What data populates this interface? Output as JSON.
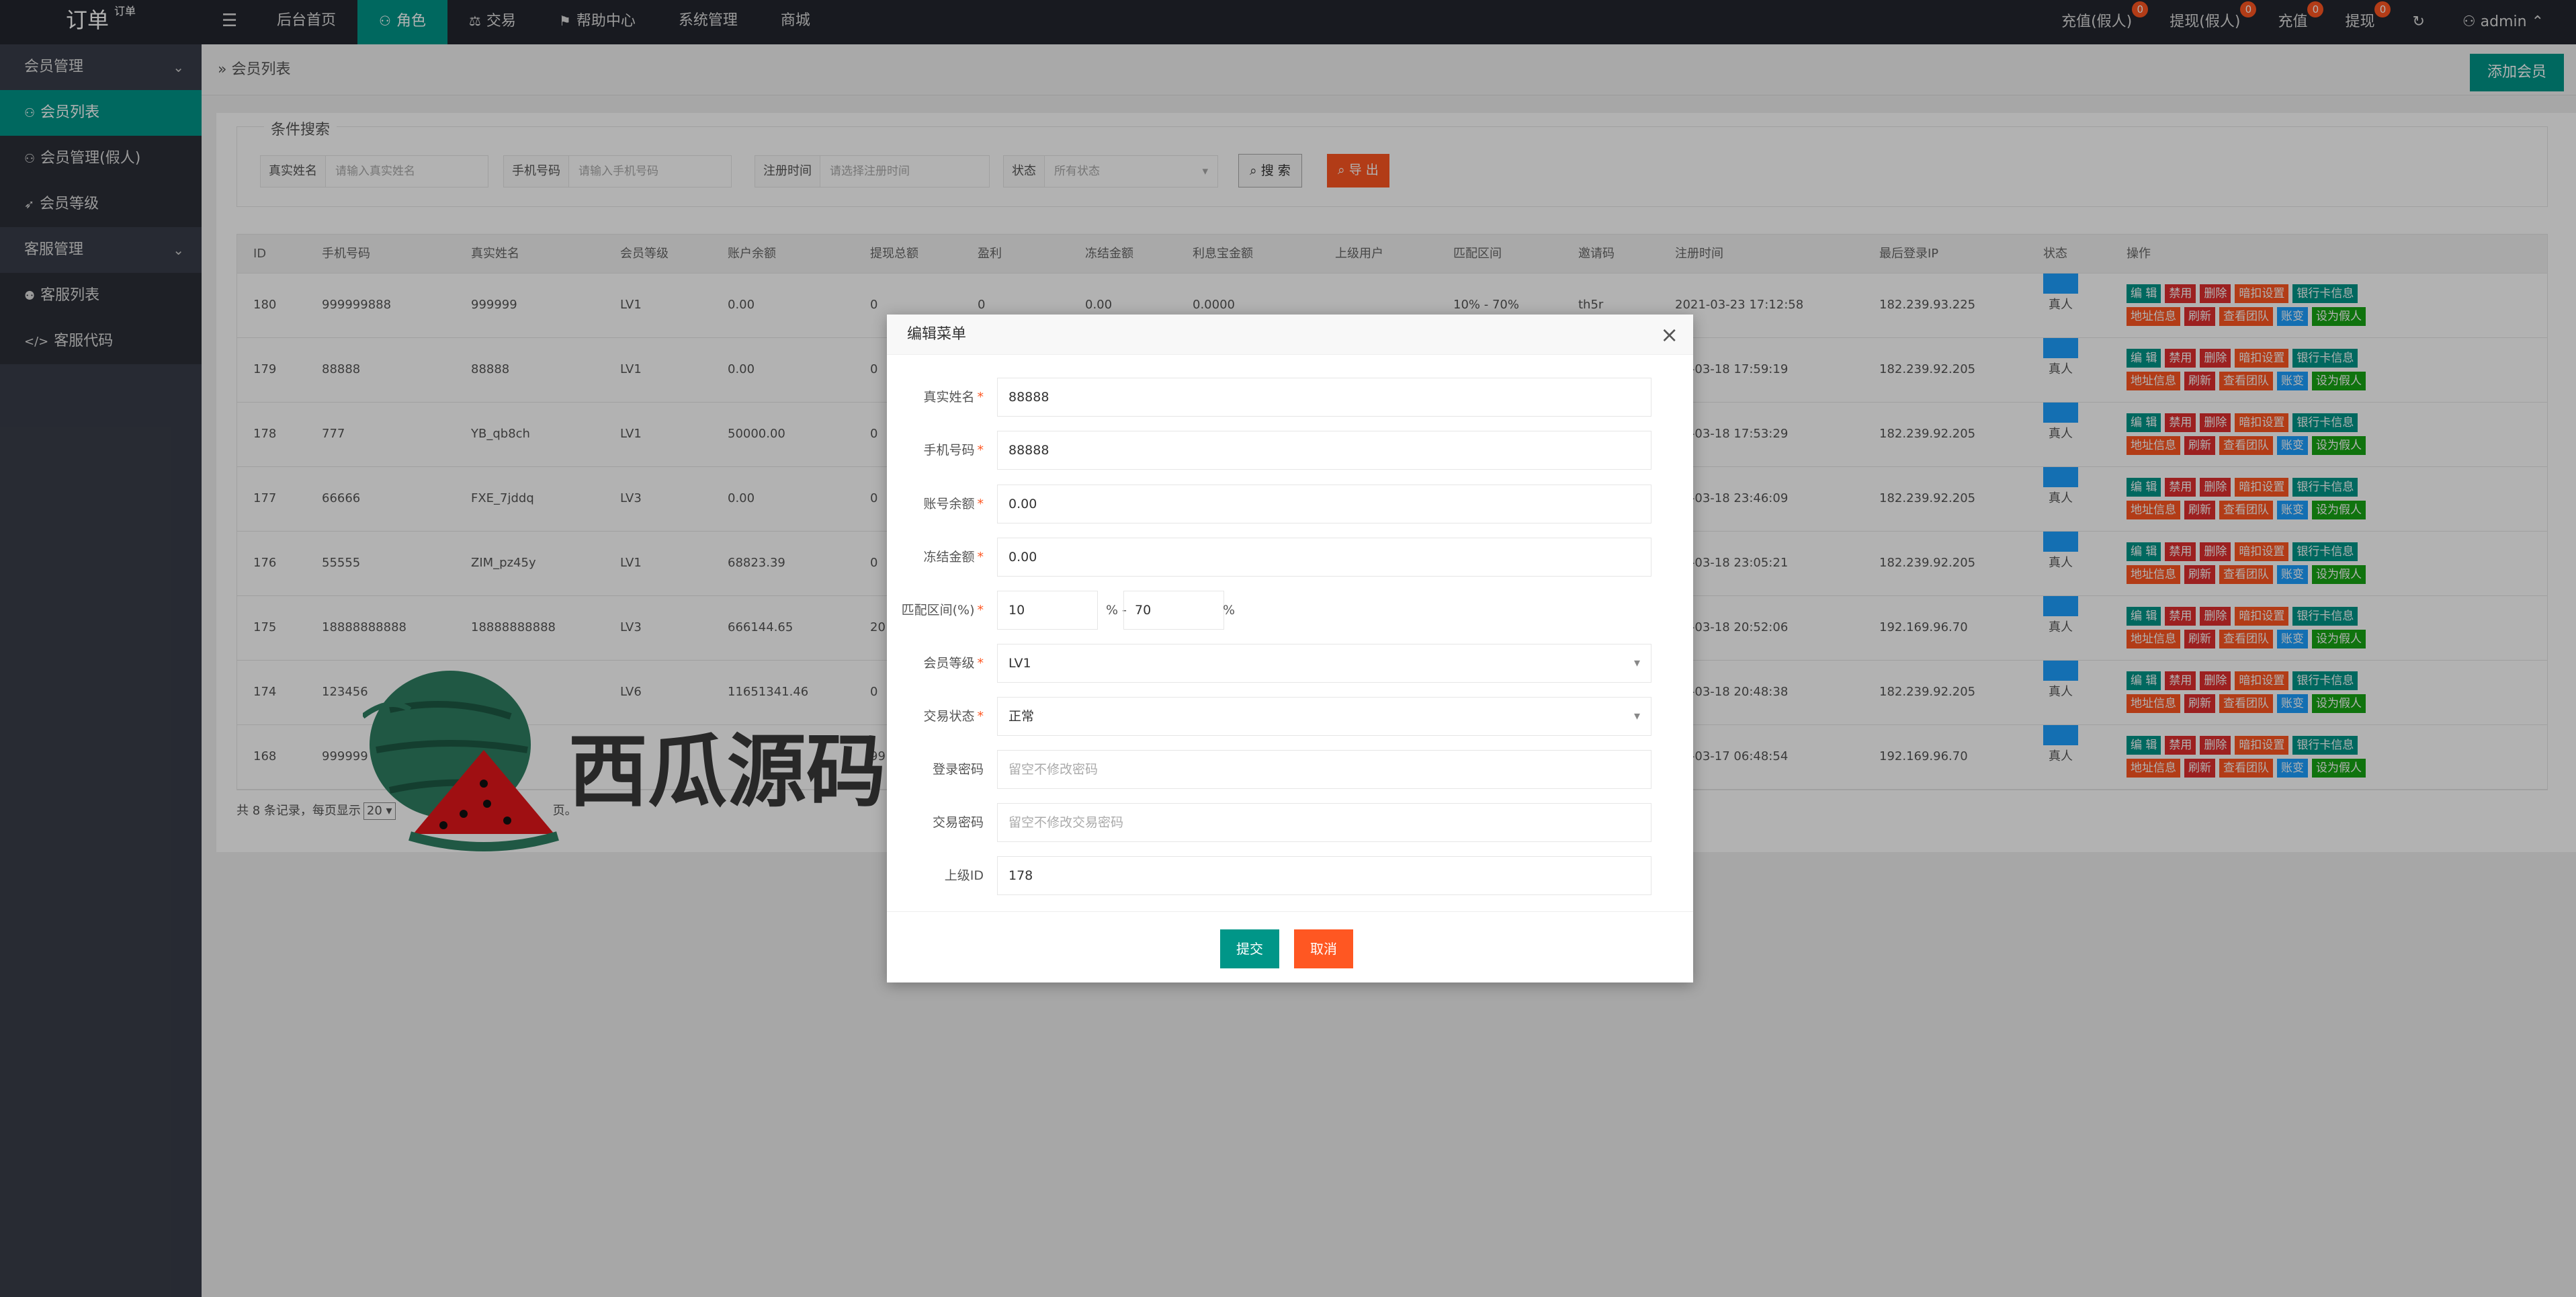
{
  "header": {
    "logo": "订单",
    "logo_sub": "订单",
    "menu_icon": "hamburger-icon",
    "nav": [
      {
        "label": "后台首页",
        "icon": ""
      },
      {
        "label": "角色",
        "icon": "user-icon"
      },
      {
        "label": "交易",
        "icon": "exchange-icon"
      },
      {
        "label": "帮助中心",
        "icon": "flag-icon"
      },
      {
        "label": "系统管理",
        "icon": ""
      },
      {
        "label": "商城",
        "icon": ""
      }
    ],
    "right": [
      {
        "label": "充值(假人)",
        "badge": "0"
      },
      {
        "label": "提现(假人)",
        "badge": "0"
      },
      {
        "label": "充值",
        "badge": "0"
      },
      {
        "label": "提现",
        "badge": "0"
      }
    ],
    "user": "admin"
  },
  "sidebar": {
    "group1": "会员管理",
    "items1": [
      "会员列表",
      "会员管理(假人)",
      "会员等级"
    ],
    "group2": "客服管理",
    "items2": [
      "客服列表",
      "客服代码"
    ]
  },
  "main": {
    "breadcrumb": "会员列表",
    "add_button": "添加会员",
    "search": {
      "legend": "条件搜索",
      "fields": [
        {
          "label": "真实姓名",
          "placeholder": "请输入真实姓名"
        },
        {
          "label": "手机号码",
          "placeholder": "请输入手机号码"
        },
        {
          "label": "注册时间",
          "placeholder": "请选择注册时间"
        },
        {
          "label": "状态",
          "placeholder": "所有状态"
        }
      ],
      "search_btn": "搜 索",
      "export_btn": "导 出"
    },
    "table": {
      "headers": [
        "ID",
        "手机号码",
        "真实姓名",
        "会员等级",
        "账户余额",
        "提现总额",
        "盈利",
        "冻结金额",
        "利息宝金额",
        "上级用户",
        "匹配区间",
        "邀请码",
        "注册时间",
        "最后登录IP",
        "状态",
        "操作"
      ],
      "rows": [
        {
          "id": "180",
          "phone": "999999888",
          "name": "999999",
          "level": "LV1",
          "balance": "0.00",
          "withdraw": "0",
          "profit": "0",
          "frozen": "0.00",
          "interest": "0.0000",
          "range": "10% - 70%",
          "invite": "th5r",
          "reg": "2021-03-23 17:12:58",
          "ip": "182.239.93.225",
          "status": "真人"
        },
        {
          "id": "179",
          "phone": "88888",
          "name": "88888",
          "level": "LV1",
          "balance": "0.00",
          "withdraw": "0",
          "reg": "21-03-18 17:59:19",
          "ip": "182.239.92.205",
          "status": "真人"
        },
        {
          "id": "178",
          "phone": "777",
          "name": "YB_qb8ch",
          "level": "LV1",
          "balance": "50000.00",
          "withdraw": "0",
          "reg": "21-03-18 17:53:29",
          "ip": "182.239.92.205",
          "status": "真人"
        },
        {
          "id": "177",
          "phone": "66666",
          "name": "FXE_7jddq",
          "level": "LV3",
          "balance": "0.00",
          "withdraw": "0",
          "reg": "21-03-18 23:46:09",
          "ip": "182.239.92.205",
          "status": "真人"
        },
        {
          "id": "176",
          "phone": "55555",
          "name": "ZIM_pz45y",
          "level": "LV1",
          "balance": "68823.39",
          "withdraw": "0",
          "reg": "21-03-18 23:05:21",
          "ip": "182.239.92.205",
          "status": "真人"
        },
        {
          "id": "175",
          "phone": "18888888888",
          "name": "18888888888",
          "level": "LV3",
          "balance": "666144.65",
          "withdraw": "20",
          "reg": "21-03-18 20:52:06",
          "ip": "192.169.96.70",
          "status": "真人"
        },
        {
          "id": "174",
          "phone": "123456",
          "name": "p8r",
          "level": "LV6",
          "balance": "11651341.46",
          "withdraw": "0",
          "reg": "21-03-18 20:48:38",
          "ip": "182.239.92.205",
          "status": "真人"
        },
        {
          "id": "168",
          "phone": "999999",
          "name": "",
          "level": "",
          "balance": "",
          "withdraw": "99",
          "reg": "21-03-17 06:48:54",
          "ip": "192.169.96.70",
          "status": "真人"
        }
      ],
      "ops_row1": [
        "编 辑",
        "禁用",
        "删除",
        "暗扣设置",
        "银行卡信息"
      ],
      "ops_row2": [
        "地址信息",
        "刷新",
        "查看团队",
        "账变",
        "设为假人"
      ]
    },
    "pager": {
      "prefix": "共 8 条记录，每页显示",
      "per_page": "20",
      "suffix": "页。"
    }
  },
  "modal": {
    "title": "编辑菜单",
    "fields": [
      {
        "label": "真实姓名",
        "value": "88888",
        "required": true
      },
      {
        "label": "手机号码",
        "value": "88888",
        "required": true
      },
      {
        "label": "账号余额",
        "value": "0.00",
        "required": true
      },
      {
        "label": "冻结金额",
        "value": "0.00",
        "required": true
      }
    ],
    "range": {
      "label": "匹配区间(%)",
      "min": "10",
      "sep": "% -",
      "max": "70",
      "unit": "%"
    },
    "level": {
      "label": "会员等级",
      "value": "LV1"
    },
    "trade_status": {
      "label": "交易状态",
      "value": "正常"
    },
    "login_pwd": {
      "label": "登录密码",
      "placeholder": "留空不修改密码"
    },
    "trade_pwd": {
      "label": "交易密码",
      "placeholder": "留空不修改交易密码"
    },
    "parent": {
      "label": "上级ID",
      "value": "178"
    },
    "submit": "提交",
    "cancel": "取消"
  },
  "watermark": {
    "text": "西瓜源码"
  },
  "colors": {
    "accent": "#009688",
    "danger": "#ff5722",
    "red": "#e02f2f",
    "blue": "#1e9fff",
    "green": "#18a515",
    "header_bg": "#23262e",
    "sidebar_bg": "#393d49"
  }
}
